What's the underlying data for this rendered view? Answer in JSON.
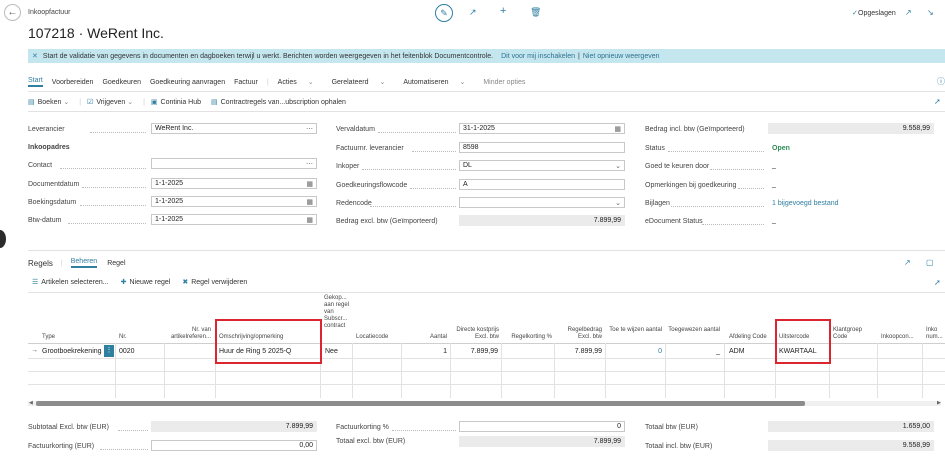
{
  "header": {
    "breadcrumb": "Inkoopfactuur",
    "title": "107218 · WeRent Inc.",
    "saved_status": "Opgeslagen",
    "icons": [
      "back-icon",
      "edit-icon",
      "share-icon",
      "add-icon",
      "delete-icon",
      "check-icon",
      "open-new-icon",
      "collapse-icon"
    ]
  },
  "banner": {
    "text": "Start de validatie van gegevens in documenten en dagboeken terwijl u werkt. Berichten worden weergegeven in het feitenblok Documentcontrole.",
    "link1": "Dit voor mij inschakelen",
    "divider": "|",
    "link2": "Niet opnieuw weergeven"
  },
  "actions": {
    "tabs": [
      "Start",
      "Voorbereiden",
      "Goedkeuren",
      "Goedkeuring aanvragen",
      "Factuur"
    ],
    "menus": [
      "Acties",
      "Gerelateerd",
      "Automatiseren"
    ],
    "less": "Minder opties",
    "toolbar": [
      "Boeken",
      "Vrijgeven",
      "Continia Hub",
      "Contractregels van...ubscription ophalen"
    ]
  },
  "form": {
    "vendor_label": "Leverancier",
    "vendor_value": "WeRent Inc.",
    "purchase_address_label": "Inkoopadres",
    "contact_label": "Contact",
    "contact_value": "",
    "doc_date_label": "Documentdatum",
    "doc_date_value": "1-1-2025",
    "posting_date_label": "Boekingsdatum",
    "posting_date_value": "1-1-2025",
    "vat_date_label": "Btw-datum",
    "vat_date_value": "1-1-2025",
    "due_date_label": "Vervaldatum",
    "due_date_value": "31-1-2025",
    "vendor_invoice_label": "Factuurnr. leverancier",
    "vendor_invoice_value": "8598",
    "purchaser_label": "Inkoper",
    "purchaser_value": "DL",
    "approval_flow_label": "Goedkeuringsflowcode",
    "approval_flow_value": "A",
    "reason_label": "Redencode",
    "reason_value": "",
    "amount_excl_label": "Bedrag excl. btw (Geïmporteerd)",
    "amount_excl_value": "7.899,99",
    "amount_incl_label": "Bedrag incl. btw (Geïmporteerd)",
    "amount_incl_value": "9.558,99",
    "status_label": "Status",
    "status_value": "Open",
    "approver_label": "Goed te keuren door",
    "approver_value": "_",
    "approval_comments_label": "Opmerkingen bij goedkeuring",
    "approval_comments_value": "_",
    "attachments_label": "Bijlagen",
    "attachments_value": "1 bijgevoegd bestand",
    "edoc_label": "eDocument Status",
    "edoc_value": "_"
  },
  "lines": {
    "title": "Regels",
    "tabs": [
      "Beheren",
      "Regel"
    ],
    "toolbar": [
      "Artikelen selecteren...",
      "Nieuwe regel",
      "Regel verwijderen"
    ],
    "columns": {
      "type": "Type",
      "no": "Nr.",
      "item_ref": "Nr. van artikelreferen...",
      "description": "Omschrijving/opmerking",
      "linked": "Gekop... aan regel van Subscr... contract",
      "location": "Locatiecode",
      "qty": "Aantal",
      "direct_cost": "Directe kostprijs Excl. btw",
      "line_discount": "Regelkorting %",
      "line_amount": "Regelbedrag Excl. btw",
      "qty_to_assign": "Toe te wijzen aantal",
      "qty_assigned": "Toegewezen aantal",
      "department": "Afdeling Code",
      "cost_code": "Uitstercode",
      "customer_group": "Klantgroep Code",
      "purchase_con": "Inkoopcon...",
      "more": "Inko num..."
    },
    "rows": [
      {
        "type": "Grootboekrekening",
        "no": "0020",
        "item_ref": "",
        "description": "Huur de Ring 5 2025-Q",
        "linked": "Nee",
        "location": "",
        "qty": "1",
        "direct_cost": "7.899,99",
        "line_discount": "",
        "line_amount": "7.899,99",
        "qty_to_assign": "0",
        "qty_assigned": "_",
        "department": "ADM",
        "cost_code": "KWARTAAL"
      }
    ]
  },
  "totals": {
    "subtotal_label": "Subtotaal Excl. btw (EUR)",
    "subtotal_value": "7.899,99",
    "invoice_discount_amt_label": "Factuurkorting (EUR)",
    "invoice_discount_amt_value": "0,00",
    "invoice_discount_pct_label": "Factuurkorting %",
    "invoice_discount_pct_value": "0",
    "total_excl_label": "Totaal excl. btw (EUR)",
    "total_excl_value": "7.899,99",
    "total_vat_label": "Totaal btw (EUR)",
    "total_vat_value": "1.659,00",
    "total_incl_label": "Totaal incl. btw (EUR)",
    "total_incl_value": "9.558,99"
  },
  "colors": {
    "accent": "#2f7fa0",
    "banner": "#c4e7ef",
    "highlight": "#d9262f",
    "status_open": "#2e8b57"
  }
}
